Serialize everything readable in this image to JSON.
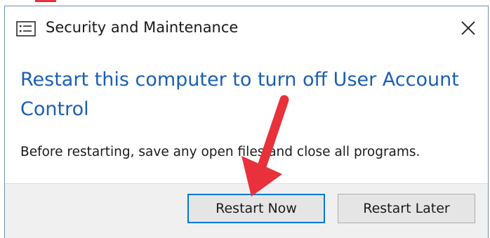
{
  "window": {
    "title": "Security and Maintenance",
    "title_icon": "security-maintenance-icon",
    "close_icon": "close-icon"
  },
  "content": {
    "heading": "Restart this computer to turn off User Account Control",
    "body": "Before restarting, save any open files and close all programs."
  },
  "buttons": {
    "restart_now": "Restart Now",
    "restart_later": "Restart Later"
  },
  "annotation": {
    "arrow_icon": "red-arrow-icon",
    "arrow_color": "#e8313a"
  },
  "colors": {
    "heading": "#1a5fb4",
    "primary_button_border": "#0078d7"
  }
}
